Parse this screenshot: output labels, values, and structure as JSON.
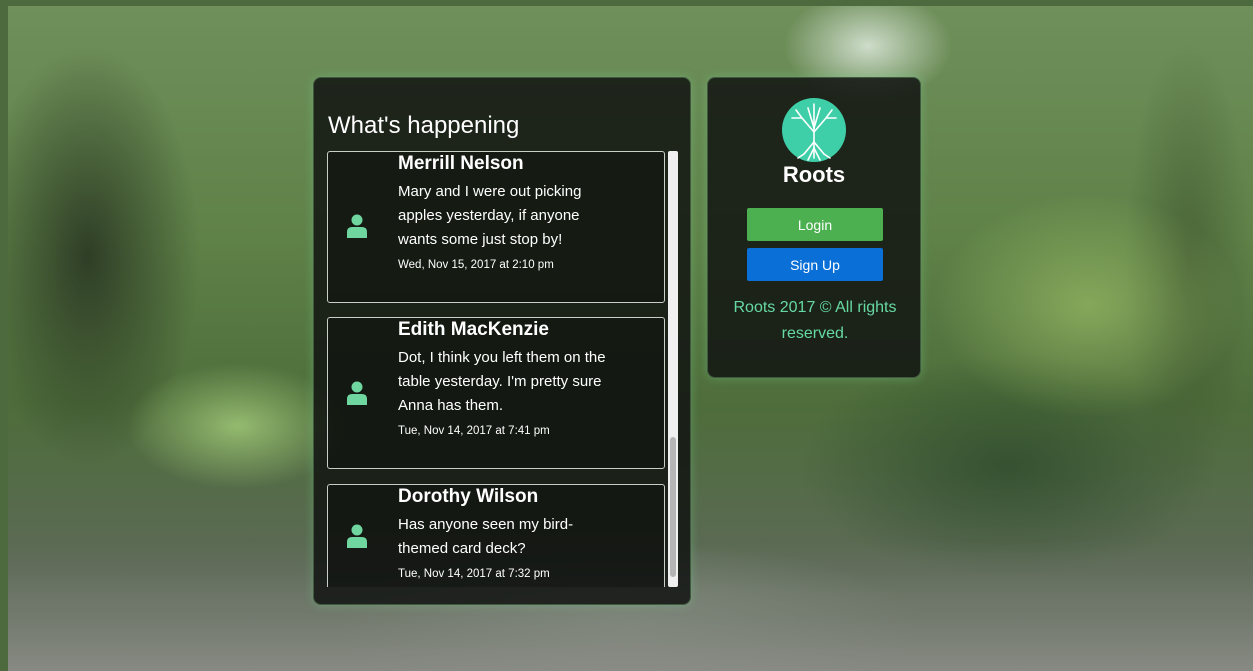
{
  "feed": {
    "title": "What's happening",
    "posts": [
      {
        "author": "Merrill Nelson",
        "text": "Mary and I were out picking apples yesterday, if anyone wants some just stop by!",
        "time": "Wed, Nov 15, 2017 at 2:10 pm"
      },
      {
        "author": "Edith MacKenzie",
        "text": "Dot, I think you left them on the table yesterday. I'm pretty sure Anna has them.",
        "time": "Tue, Nov 14, 2017 at 7:41 pm"
      },
      {
        "author": "Dorothy Wilson",
        "text": "Has anyone seen my bird-themed card deck?",
        "time": "Tue, Nov 14, 2017 at 7:32 pm"
      }
    ]
  },
  "account": {
    "logo_icon": "tree-logo-icon",
    "brand": "Roots",
    "login_label": "Login",
    "signup_label": "Sign Up",
    "copyright": "Roots 2017 © All rights reserved."
  },
  "colors": {
    "accent_green": "#66d9a3",
    "login_button": "#4caf50",
    "signup_button": "#0a6fd6",
    "logo_teal": "#3fcfa8",
    "avatar_green": "#6fd6a0"
  },
  "icons": {
    "avatar": "user-icon"
  }
}
